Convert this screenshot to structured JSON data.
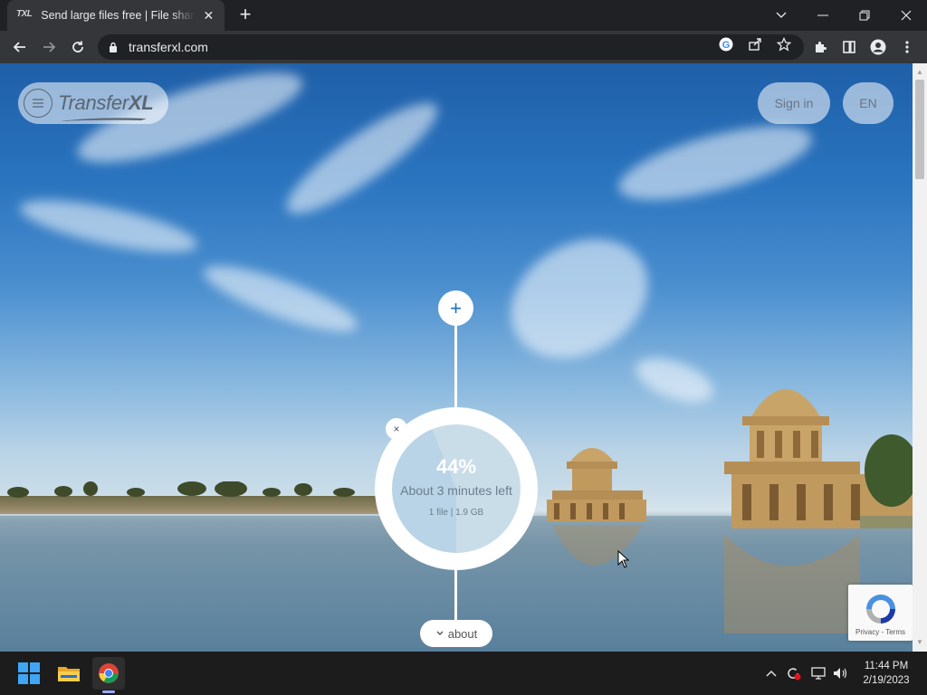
{
  "browser": {
    "tab_title": "Send large files free | File sharing",
    "tab_favicon_text": "TXL",
    "url": "transferxl.com"
  },
  "site": {
    "logo_text_regular": "Transfer",
    "logo_text_bold": "XL",
    "sign_in_label": "Sign in",
    "language_label": "EN",
    "add_button_label": "+",
    "cancel_label": "×",
    "upload": {
      "progress_percent_text": "44%",
      "progress_fraction": 0.44,
      "eta_text": "About 3 minutes left",
      "file_info_text": "1 file | 1.9 GB"
    },
    "about_label": "about",
    "recaptcha_text": "Privacy - Terms"
  },
  "taskbar": {
    "time": "11:44 PM",
    "date": "2/19/2023"
  },
  "colors": {
    "accent_blue": "#1a6fc4",
    "progress_fill": "#b9d4e6",
    "progress_remaining": "#c9dde9"
  }
}
